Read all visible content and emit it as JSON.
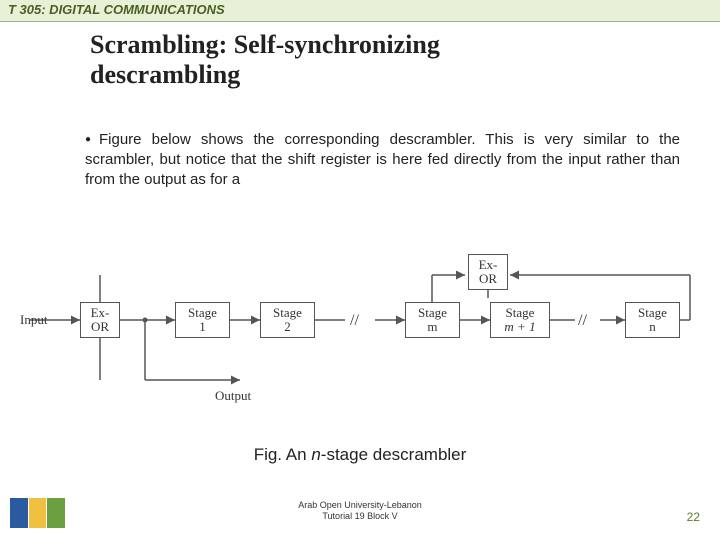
{
  "header": {
    "course": "T 305: DIGITAL COMMUNICATIONS"
  },
  "title_line1": "Scrambling: Self-synchronizing",
  "title_line2": "descrambling",
  "bullet_text": "Figure below shows the corresponding descrambler. This is very similar to the scrambler, but notice that the shift register is here fed directly from the input rather than from the output as for a",
  "diagram": {
    "input": "Input",
    "output": "Output",
    "exor": "Ex-\nOR",
    "stage1": "Stage\n1",
    "stage2": "Stage\n2",
    "break": "//",
    "stagem": "Stage\nm",
    "stagem1_a": "Stage",
    "stagem1_b": "m + 1",
    "stagen": "Stage\nn"
  },
  "caption_prefix": "Fig. An ",
  "caption_var": "n",
  "caption_suffix": "-stage descrambler",
  "footer_line1": "Arab Open University-Lebanon",
  "footer_line2": "Tutorial 19 Block V",
  "page_number": "22"
}
